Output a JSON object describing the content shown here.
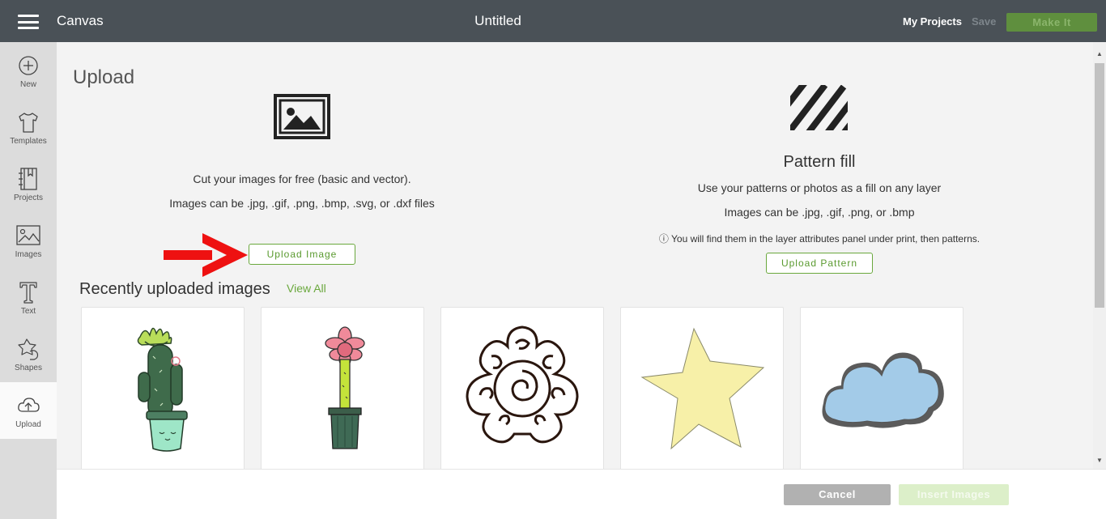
{
  "header": {
    "app_name": "Canvas",
    "doc_title": "Untitled",
    "my_projects": "My Projects",
    "save": "Save",
    "make_it": "Make It"
  },
  "sidebar": {
    "items": [
      {
        "label": "New",
        "icon": "plus-circle-icon"
      },
      {
        "label": "Templates",
        "icon": "tshirt-icon"
      },
      {
        "label": "Projects",
        "icon": "bookmark-book-icon"
      },
      {
        "label": "Images",
        "icon": "image-icon"
      },
      {
        "label": "Text",
        "icon": "text-t-icon"
      },
      {
        "label": "Shapes",
        "icon": "shapes-icon"
      },
      {
        "label": "Upload",
        "icon": "cloud-upload-icon"
      }
    ],
    "active": "Upload"
  },
  "upload": {
    "title": "Upload",
    "desc1": "Cut your images for free (basic and vector).",
    "desc2": "Images can be .jpg, .gif, .png, .bmp, .svg, or .dxf files",
    "button": "Upload Image"
  },
  "pattern": {
    "title": "Pattern fill",
    "desc1": "Use your patterns or photos as a fill on any layer",
    "desc2": "Images can be .jpg, .gif, .png, or .bmp",
    "note": "ⓘ You will find them in the layer attributes panel under print, then patterns.",
    "button": "Upload Pattern"
  },
  "recent": {
    "title": "Recently uploaded images",
    "view_all": "View All",
    "images": [
      "cactus-image",
      "flower-pot-image",
      "mandala-image",
      "star-image",
      "cloud-image"
    ]
  },
  "footer": {
    "cancel": "Cancel",
    "insert": "Insert Images"
  },
  "colors": {
    "topbar": "#4a5157",
    "accent_green": "#6aa83d",
    "make_it_bg": "#5f8f3e",
    "arrow_red": "#ee1111"
  }
}
